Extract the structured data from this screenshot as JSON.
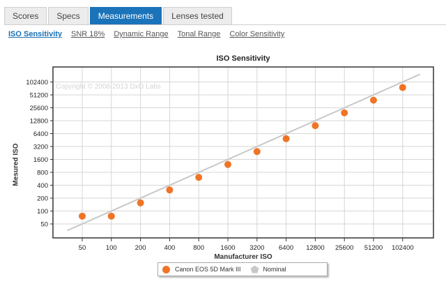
{
  "tabs": [
    {
      "label": "Scores",
      "active": false
    },
    {
      "label": "Specs",
      "active": false
    },
    {
      "label": "Measurements",
      "active": true
    },
    {
      "label": "Lenses tested",
      "active": false
    }
  ],
  "subnav": [
    {
      "label": "ISO Sensitivity",
      "active": true
    },
    {
      "label": "SNR 18%",
      "active": false
    },
    {
      "label": "Dynamic Range",
      "active": false
    },
    {
      "label": "Tonal Range",
      "active": false
    },
    {
      "label": "Color Sensitivity",
      "active": false
    }
  ],
  "chart_data": {
    "type": "scatter",
    "title": "ISO Sensitivity",
    "xlabel": "Manufacturer ISO",
    "ylabel": "Mesured ISO",
    "watermark": "Copyright © 2008-2013 DxO Labs",
    "x_scale": "log2",
    "y_scale": "log2",
    "x_ticks": [
      50,
      100,
      200,
      400,
      800,
      1600,
      3200,
      6400,
      12800,
      25600,
      51200,
      102400
    ],
    "y_ticks": [
      50,
      100,
      200,
      400,
      800,
      1600,
      3200,
      6400,
      12800,
      25600,
      51200,
      102400
    ],
    "grid": true,
    "legend_position": "bottom",
    "series": [
      {
        "name": "Canon EOS 5D Mark III",
        "type": "scatter",
        "color": "#f07426",
        "x": [
          50,
          100,
          200,
          400,
          800,
          1600,
          3200,
          6400,
          12800,
          25600,
          51200,
          102400
        ],
        "y": [
          76,
          76,
          155,
          310,
          610,
          1220,
          2440,
          4870,
          9800,
          19500,
          38500,
          76000
        ]
      },
      {
        "name": "Nominal",
        "type": "line",
        "color": "#c8c8c8",
        "x": [
          35,
          155000
        ],
        "y": [
          35,
          155000
        ]
      }
    ]
  }
}
